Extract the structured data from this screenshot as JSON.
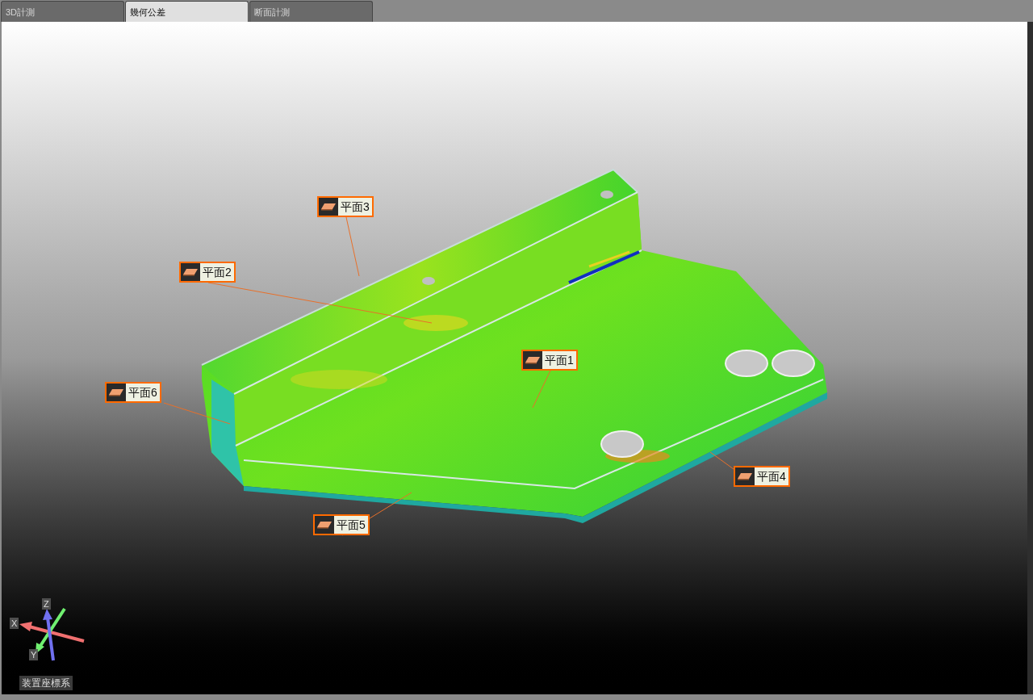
{
  "tabs": [
    {
      "label": "3D計測",
      "selected": false
    },
    {
      "label": "幾何公差",
      "selected": true
    },
    {
      "label": "断面計測",
      "selected": false
    }
  ],
  "viewport": {
    "callouts": [
      {
        "label": "平面3"
      },
      {
        "label": "平面2"
      },
      {
        "label": "平面1"
      },
      {
        "label": "平面6"
      },
      {
        "label": "平面4"
      },
      {
        "label": "平面5"
      }
    ],
    "axes": {
      "x_label": "X",
      "y_label": "Y",
      "z_label": "Z",
      "caption": "装置座標系"
    }
  }
}
